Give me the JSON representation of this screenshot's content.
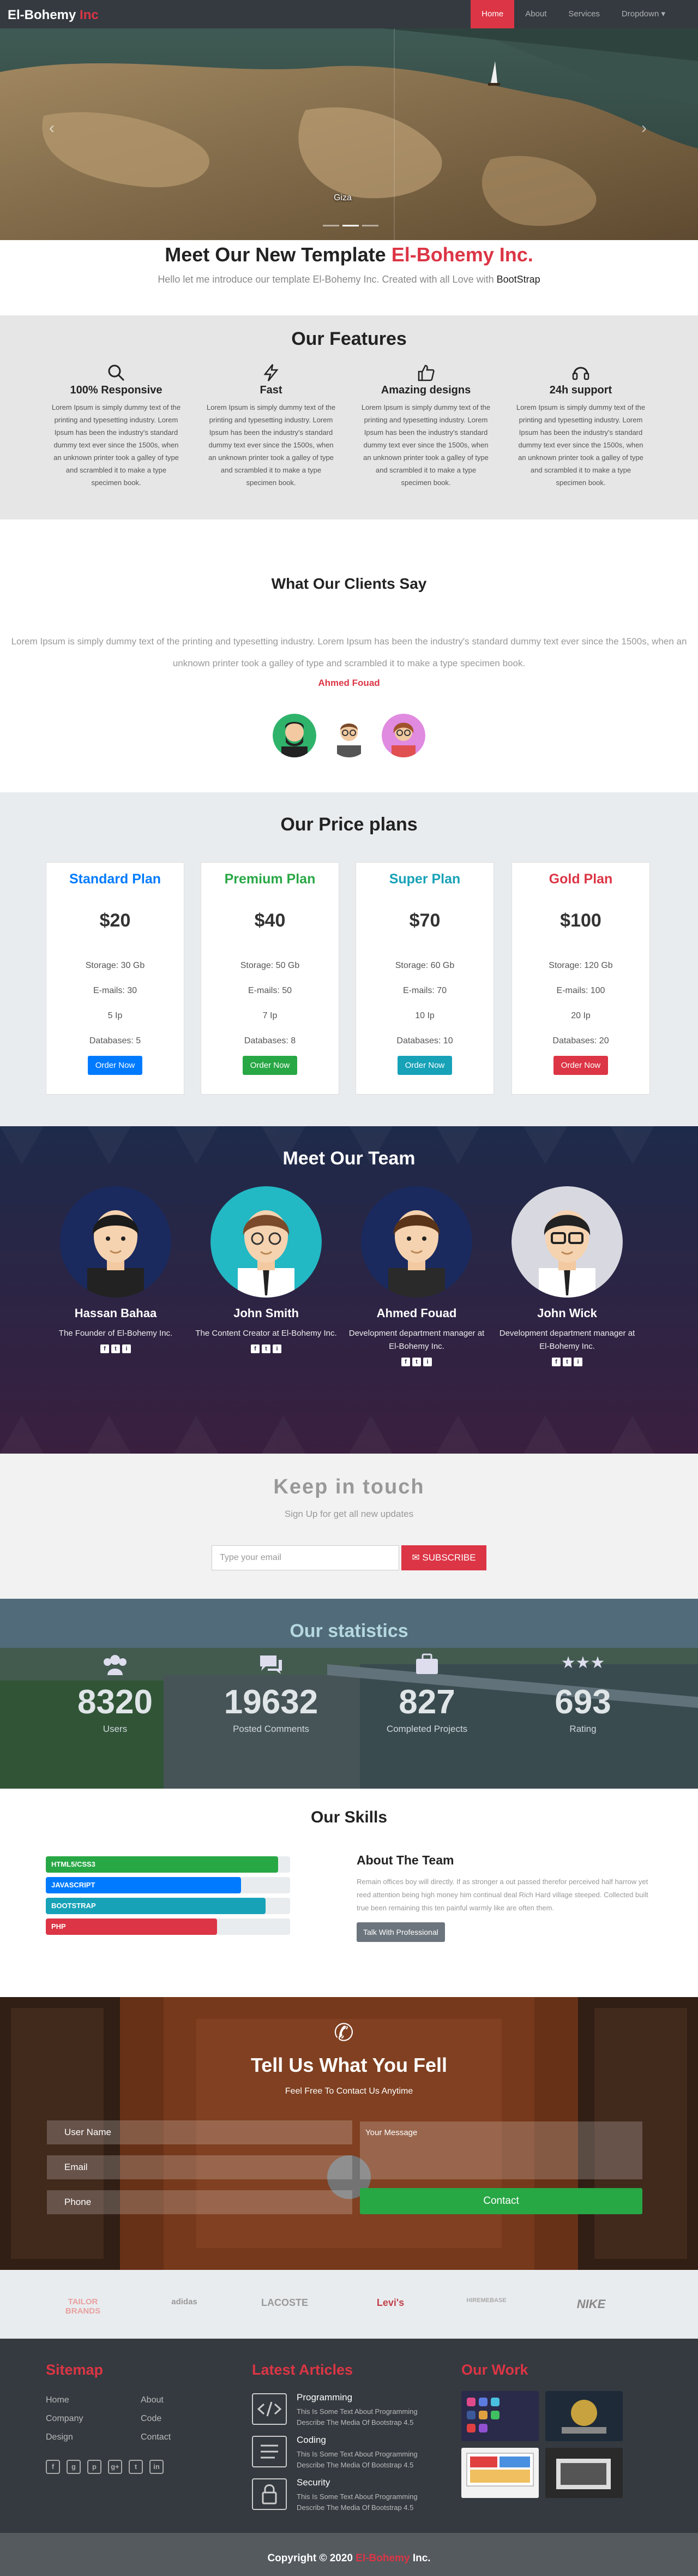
{
  "nav": {
    "brand": "El-Bohemy",
    "brand_accent": "Inc",
    "links": [
      "Home",
      "About",
      "Services",
      "Dropdown ▾"
    ]
  },
  "hero": {
    "caption": "Giza",
    "prev": "‹",
    "next": "›"
  },
  "intro": {
    "title": "Meet Our New Template",
    "title_accent": "El-Bohemy Inc.",
    "subtitle": "Hello let me introduce our template El-Bohemy Inc. Created with all Love with",
    "subtitle_accent": "BootStrap"
  },
  "features": {
    "title": "Our Features",
    "items": [
      {
        "icon": "search-icon",
        "title": "100% Responsive",
        "text": "Lorem Ipsum is simply dummy text of the printing and typesetting industry. Lorem Ipsum has been the industry's standard dummy text ever since the 1500s, when an unknown printer took a galley of type and scrambled it to make a type specimen book."
      },
      {
        "icon": "bolt-icon",
        "title": "Fast",
        "text": "Lorem Ipsum is simply dummy text of the printing and typesetting industry. Lorem Ipsum has been the industry's standard dummy text ever since the 1500s, when an unknown printer took a galley of type and scrambled it to make a type specimen book."
      },
      {
        "icon": "thumbs-up-icon",
        "title": "Amazing designs",
        "text": "Lorem Ipsum is simply dummy text of the printing and typesetting industry. Lorem Ipsum has been the industry's standard dummy text ever since the 1500s, when an unknown printer took a galley of type and scrambled it to make a type specimen book."
      },
      {
        "icon": "headset-icon",
        "title": "24h support",
        "text": "Lorem Ipsum is simply dummy text of the printing and typesetting industry. Lorem Ipsum has been the industry's standard dummy text ever since the 1500s, when an unknown printer took a galley of type and scrambled it to make a type specimen book."
      }
    ]
  },
  "clients": {
    "title": "What Our Clients Say",
    "quote": "Lorem Ipsum is simply dummy text of the printing and typesetting industry. Lorem Ipsum has been the industry's standard dummy text ever since the 1500s, when an unknown printer took a galley of type and scrambled it to make a type specimen book.",
    "author": "Ahmed Fouad"
  },
  "pricing": {
    "title": "Our Price plans",
    "plans": [
      {
        "name": "Standard Plan",
        "price": "$20",
        "storage": "Storage: 30 Gb",
        "emails": "E-mails: 30",
        "ip": "5 Ip",
        "db": "Databases: 5",
        "button": "Order Now",
        "color": "#007bff"
      },
      {
        "name": "Premium Plan",
        "price": "$40",
        "storage": "Storage: 50 Gb",
        "emails": "E-mails: 50",
        "ip": "7 Ip",
        "db": "Databases: 8",
        "button": "Order Now",
        "color": "#28a745"
      },
      {
        "name": "Super Plan",
        "price": "$70",
        "storage": "Storage: 60 Gb",
        "emails": "E-mails: 70",
        "ip": "10 Ip",
        "db": "Databases: 10",
        "button": "Order Now",
        "color": "#17a2b8"
      },
      {
        "name": "Gold Plan",
        "price": "$100",
        "storage": "Storage: 120 Gb",
        "emails": "E-mails: 100",
        "ip": "20 Ip",
        "db": "Databases: 20",
        "button": "Order Now",
        "color": "#dc3545"
      }
    ]
  },
  "team": {
    "title": "Meet Our Team",
    "members": [
      {
        "name": "Hassan Bahaa",
        "role": "The Founder of El-Bohemy Inc."
      },
      {
        "name": "John Smith",
        "role": "The Content Creator at El-Bohemy Inc."
      },
      {
        "name": "Ahmed Fouad",
        "role": "Development department manager at El-Bohemy Inc."
      },
      {
        "name": "John Wick",
        "role": "Development department manager at El-Bohemy Inc."
      }
    ]
  },
  "news": {
    "title": "Keep in touch",
    "subtitle": "Sign Up for get all new updates",
    "placeholder": "Type your email",
    "button": "✉ SUBSCRIBE"
  },
  "stats": {
    "title": "Our statistics",
    "items": [
      {
        "icon": "users-icon",
        "value": "8320",
        "label": "Users"
      },
      {
        "icon": "comments-icon",
        "value": "19632",
        "label": "Posted Comments"
      },
      {
        "icon": "briefcase-icon",
        "value": "827",
        "label": "Completed Projects"
      },
      {
        "icon": "stars-icon",
        "value": "693",
        "label": "Rating"
      }
    ]
  },
  "skills": {
    "title": "Our Skills",
    "bars": [
      {
        "label": "HTML5/CSS3",
        "percent": 95,
        "color": "#28a745"
      },
      {
        "label": "JAVASCRIPT",
        "percent": 80,
        "color": "#007bff"
      },
      {
        "label": "BOOTSTRAP",
        "percent": 90,
        "color": "#17a2b8"
      },
      {
        "label": "PHP",
        "percent": 70,
        "color": "#dc3545"
      }
    ],
    "about_title": "About The Team",
    "about_text": "Remain offices boy will directly. If as stronger a out passed therefor perceived half harrow yet reed attention being high money him continual deal Rich Hard village steeped. Collected built true been remaining this ten painful warmly like are often them.",
    "about_button": "Talk With Professional"
  },
  "contact": {
    "title": "Tell Us What You Fell",
    "subtitle": "Feel Free To Contact Us Anytime",
    "username": "User Name",
    "email": "Email",
    "phone": "Phone",
    "message": "Your Message",
    "button": "Contact"
  },
  "brands": [
    "TAILOR BRANDS",
    "adidas",
    "LACOSTE",
    "Levi's",
    "HIREMEBASE",
    "NIKE"
  ],
  "footer": {
    "sitemap_title": "Sitemap",
    "sitemap_col1": [
      "Home",
      "Company",
      "Design"
    ],
    "sitemap_col2": [
      "About",
      "Code",
      "Contact"
    ],
    "social": [
      "f",
      "g",
      "p",
      "g+",
      "t",
      "in"
    ],
    "articles_title": "Latest Articles",
    "articles": [
      {
        "icon": "code-icon",
        "title": "Programming",
        "desc": "This Is Some Text About Programming Describe The Media Of Bootstrap 4.5"
      },
      {
        "icon": "list-icon",
        "title": "Coding",
        "desc": "This Is Some Text About Programming Describe The Media Of Bootstrap 4.5"
      },
      {
        "icon": "lock-icon",
        "title": "Security",
        "desc": "This Is Some Text About Programming Describe The Media Of Bootstrap 4.5"
      }
    ],
    "work_title": "Our Work"
  },
  "copyright": {
    "text": "Copyright © 2020",
    "accent": "El-Bohemy",
    "suffix": "Inc."
  }
}
